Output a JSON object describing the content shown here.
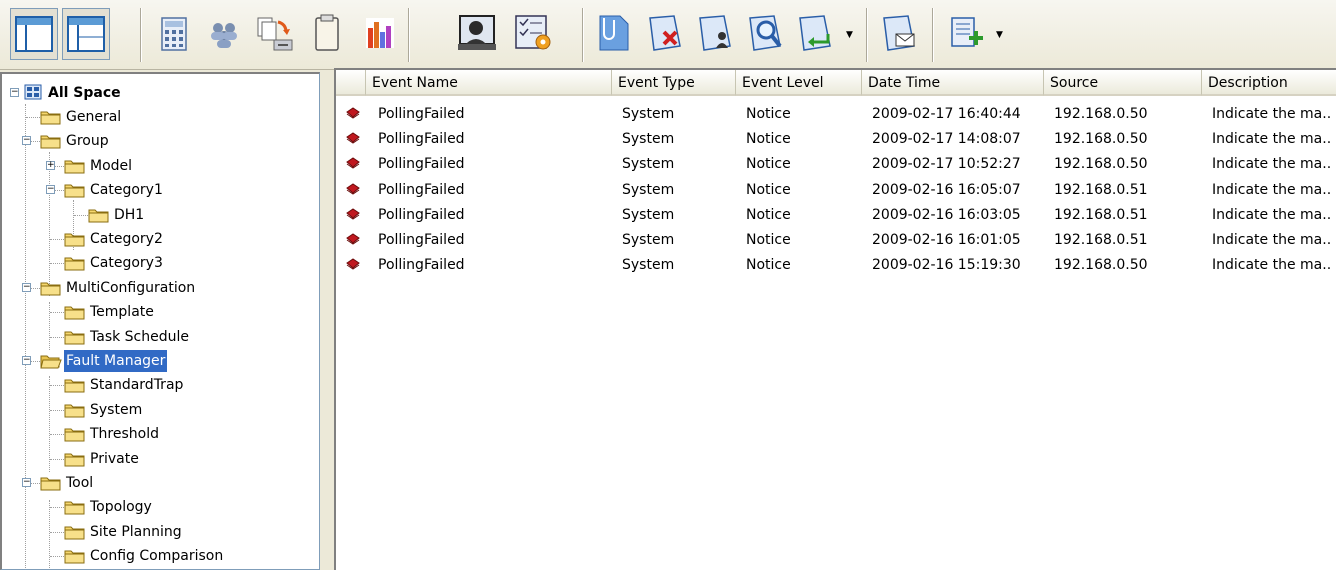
{
  "toolbar": {
    "buttons": [
      {
        "name": "window-layout-1-icon"
      },
      {
        "name": "window-layout-2-icon"
      },
      {
        "name": "calculator-icon"
      },
      {
        "name": "users-icon"
      },
      {
        "name": "copy-to-device-icon"
      },
      {
        "name": "clipboard-icon"
      },
      {
        "name": "bar-chart-icon"
      },
      {
        "name": "operator-icon"
      },
      {
        "name": "settings-checklist-icon"
      },
      {
        "name": "attach-icon"
      },
      {
        "name": "delete-page-icon"
      },
      {
        "name": "page-user-icon"
      },
      {
        "name": "search-page-icon"
      },
      {
        "name": "export-page-icon"
      },
      {
        "name": "mail-page-icon"
      },
      {
        "name": "add-list-icon"
      }
    ]
  },
  "tree": {
    "root": "All Space",
    "items": [
      {
        "label": "General"
      },
      {
        "label": "Group"
      },
      {
        "label": "Model"
      },
      {
        "label": "Category1"
      },
      {
        "label": "DH1"
      },
      {
        "label": "Category2"
      },
      {
        "label": "Category3"
      },
      {
        "label": "MultiConfiguration"
      },
      {
        "label": "Template"
      },
      {
        "label": "Task Schedule"
      },
      {
        "label": "Fault Manager"
      },
      {
        "label": "StandardTrap"
      },
      {
        "label": "System"
      },
      {
        "label": "Threshold"
      },
      {
        "label": "Private"
      },
      {
        "label": "Tool"
      },
      {
        "label": "Topology"
      },
      {
        "label": "Site Planning"
      },
      {
        "label": "Config Comparison"
      }
    ],
    "selected": "Fault Manager"
  },
  "table": {
    "columns": [
      "Event Name",
      "Event Type",
      "Event Level",
      "Date Time",
      "Source",
      "Description"
    ],
    "rows": [
      [
        "PollingFailed",
        "System",
        "Notice",
        "2009-02-17 16:40:44",
        "192.168.0.50",
        "Indicate the ma.."
      ],
      [
        "PollingFailed",
        "System",
        "Notice",
        "2009-02-17 14:08:07",
        "192.168.0.50",
        "Indicate the ma.."
      ],
      [
        "PollingFailed",
        "System",
        "Notice",
        "2009-02-17 10:52:27",
        "192.168.0.50",
        "Indicate the ma.."
      ],
      [
        "PollingFailed",
        "System",
        "Notice",
        "2009-02-16 16:05:07",
        "192.168.0.51",
        "Indicate the ma.."
      ],
      [
        "PollingFailed",
        "System",
        "Notice",
        "2009-02-16 16:03:05",
        "192.168.0.51",
        "Indicate the ma.."
      ],
      [
        "PollingFailed",
        "System",
        "Notice",
        "2009-02-16 16:01:05",
        "192.168.0.51",
        "Indicate the ma.."
      ],
      [
        "PollingFailed",
        "System",
        "Notice",
        "2009-02-16 15:19:30",
        "192.168.0.50",
        "Indicate the ma.."
      ]
    ]
  },
  "colors": {
    "selection": "#316ac5",
    "folder": "#f5d76e",
    "event_icon": "#c0181f"
  }
}
